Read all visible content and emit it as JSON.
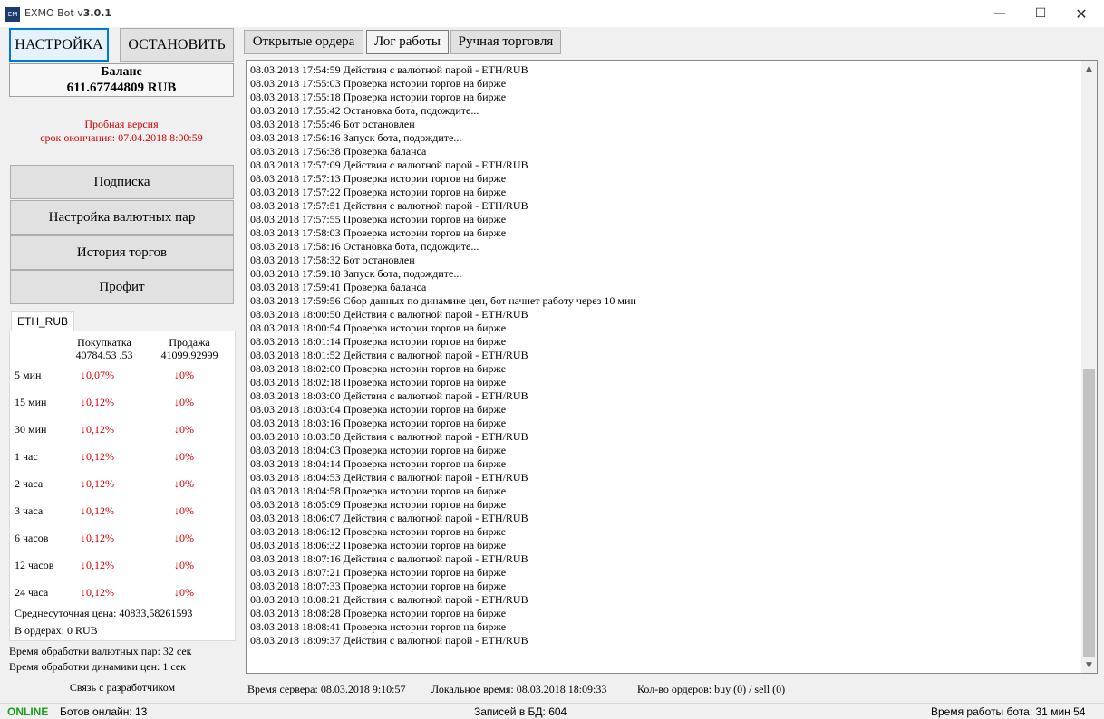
{
  "window": {
    "title_prefix": "EXMO Bot v",
    "version": "3.0.1",
    "icon_text": "EM",
    "controls": {
      "minimize": "—",
      "maximize": "☐",
      "close": "✕"
    }
  },
  "left": {
    "settings_btn": "НАСТРОЙКА",
    "stop_btn": "ОСТАНОВИТЬ",
    "balance_label": "Баланс",
    "balance_value": "611.67744809 RUB",
    "trial_line1": "Пробная версия",
    "trial_line2": "срок окончания: 07.04.2018 8:00:59",
    "menu": [
      "Подписка",
      "Настройка валютных пар",
      "История торгов",
      "Профит"
    ],
    "pair_tab": "ETH_RUB",
    "buy_label": "Покупкатка",
    "buy_price": "40784.53 .53",
    "sell_label": "Продажа",
    "sell_price": "41099.92999",
    "intervals": [
      {
        "label": "5 мин",
        "buy": "↓0,07%",
        "sell": "↓0%"
      },
      {
        "label": "15 мин",
        "buy": "↓0,12%",
        "sell": "↓0%"
      },
      {
        "label": "30 мин",
        "buy": "↓0,12%",
        "sell": "↓0%"
      },
      {
        "label": "1 час",
        "buy": "↓0,12%",
        "sell": "↓0%"
      },
      {
        "label": "2 часа",
        "buy": "↓0,12%",
        "sell": "↓0%"
      },
      {
        "label": "3 часа",
        "buy": "↓0,12%",
        "sell": "↓0%"
      },
      {
        "label": "6 часов",
        "buy": "↓0,12%",
        "sell": "↓0%"
      },
      {
        "label": "12 часов",
        "buy": "↓0,12%",
        "sell": "↓0%"
      },
      {
        "label": "24 часа",
        "buy": "↓0,12%",
        "sell": "↓0%"
      }
    ],
    "avg_price": "Среднесуточная цена: 40833,58261593",
    "in_orders": "В ордерах: 0 RUB",
    "proc_pairs": "Время обработки валютных пар: 32 сек",
    "proc_dynamics": "Время обработки динамики цен: 1 сек",
    "contact": "Связь с разработчиком"
  },
  "tabs": [
    "Открытые ордера",
    "Лог работы",
    "Ручная торговля"
  ],
  "log": [
    "08.03.2018 17:54:59 Действия с валютной парой - ETH/RUB",
    "08.03.2018 17:55:03 Проверка истории торгов на бирже",
    "08.03.2018 17:55:18 Проверка истории торгов на бирже",
    "08.03.2018 17:55:42 Остановка бота, подождите...",
    "08.03.2018 17:55:46 Бот остановлен",
    "08.03.2018 17:56:16 Запуск бота, подождите...",
    "08.03.2018 17:56:38 Проверка баланса",
    "08.03.2018 17:57:09 Действия с валютной парой - ETH/RUB",
    "08.03.2018 17:57:13 Проверка истории торгов на бирже",
    "08.03.2018 17:57:22 Проверка истории торгов на бирже",
    "08.03.2018 17:57:51 Действия с валютной парой - ETH/RUB",
    "08.03.2018 17:57:55 Проверка истории торгов на бирже",
    "08.03.2018 17:58:03 Проверка истории торгов на бирже",
    "08.03.2018 17:58:16 Остановка бота, подождите...",
    "08.03.2018 17:58:32 Бот остановлен",
    "08.03.2018 17:59:18 Запуск бота, подождите...",
    "08.03.2018 17:59:41 Проверка баланса",
    "08.03.2018 17:59:56 Сбор данных по динамике цен, бот начнет работу через 10 мин",
    "08.03.2018 18:00:50 Действия с валютной парой - ETH/RUB",
    "08.03.2018 18:00:54 Проверка истории торгов на бирже",
    "08.03.2018 18:01:14 Проверка истории торгов на бирже",
    "08.03.2018 18:01:52 Действия с валютной парой - ETH/RUB",
    "08.03.2018 18:02:00 Проверка истории торгов на бирже",
    "08.03.2018 18:02:18 Проверка истории торгов на бирже",
    "08.03.2018 18:03:00 Действия с валютной парой - ETH/RUB",
    "08.03.2018 18:03:04 Проверка истории торгов на бирже",
    "08.03.2018 18:03:16 Проверка истории торгов на бирже",
    "08.03.2018 18:03:58 Действия с валютной парой - ETH/RUB",
    "08.03.2018 18:04:03 Проверка истории торгов на бирже",
    "08.03.2018 18:04:14 Проверка истории торгов на бирже",
    "08.03.2018 18:04:53 Действия с валютной парой - ETH/RUB",
    "08.03.2018 18:04:58 Проверка истории торгов на бирже",
    "08.03.2018 18:05:09 Проверка истории торгов на бирже",
    "08.03.2018 18:06:07 Действия с валютной парой - ETH/RUB",
    "08.03.2018 18:06:12 Проверка истории торгов на бирже",
    "08.03.2018 18:06:32 Проверка истории торгов на бирже",
    "08.03.2018 18:07:16 Действия с валютной парой - ETH/RUB",
    "08.03.2018 18:07:21 Проверка истории торгов на бирже",
    "08.03.2018 18:07:33 Проверка истории торгов на бирже",
    "08.03.2018 18:08:21 Действия с валютной парой - ETH/RUB",
    "08.03.2018 18:08:28 Проверка истории торгов на бирже",
    "08.03.2018 18:08:41 Проверка истории торгов на бирже",
    "08.03.2018 18:09:37 Действия с валютной парой - ETH/RUB"
  ],
  "info": {
    "server_time": "Время сервера: 08.03.2018 9:10:57",
    "local_time": "Локальное время: 08.03.2018 18:09:33",
    "orders": "Кол-во ордеров: buy (0) / sell (0)"
  },
  "status": {
    "online": "ONLINE",
    "bots_online": "Ботов онлайн: 13",
    "db_records": "Записей в БД: 604",
    "uptime": "Время работы бота: 31 мин 54 сек"
  },
  "colors": {
    "accent": "#0078d7",
    "down": "#d40000",
    "online": "#1a9e1a"
  }
}
